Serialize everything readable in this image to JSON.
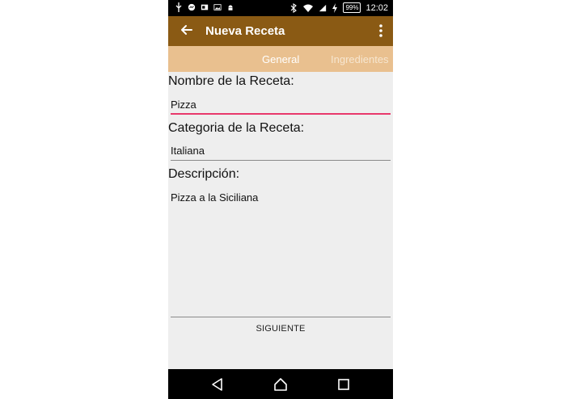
{
  "status_bar": {
    "battery": "99%",
    "time": "12:02"
  },
  "app_bar": {
    "title": "Nueva Receta"
  },
  "tabs": [
    {
      "label": "General"
    },
    {
      "label": "Ingredientes"
    }
  ],
  "form": {
    "name_label": "Nombre de la Receta:",
    "name_value": "Pizza",
    "category_label": "Categoria de la Receta:",
    "category_value": "Italiana",
    "description_label": "Descripción:",
    "description_value": "Pizza a la Siciliana"
  },
  "actions": {
    "next_label": "SIGUIENTE"
  },
  "colors": {
    "app_bar": "#8a5a14",
    "tab_bar": "#e9c08f",
    "active_underline": "#e8386b"
  }
}
